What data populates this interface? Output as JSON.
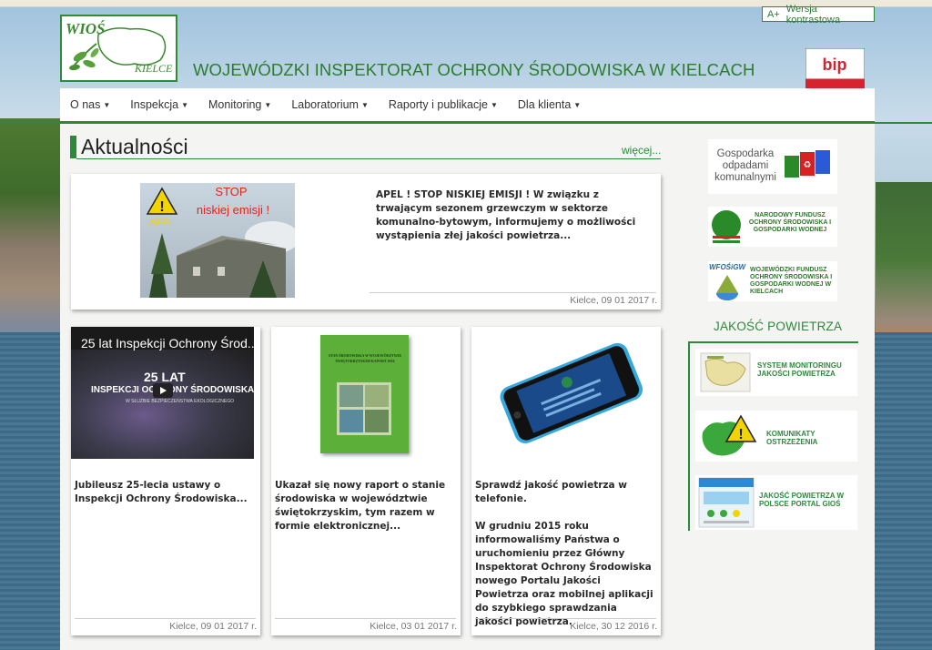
{
  "header": {
    "contrast_icon": "A+",
    "contrast_label": "Wersja kontrastowa",
    "logo_line1": "WIOŚ",
    "logo_line2": "KIELCE",
    "site_title": "WOJEWÓDZKI INSPEKTORAT OCHRONY ŚRODOWISKA W KIELCACH",
    "bip_label": "bip"
  },
  "nav": [
    {
      "label": "O nas"
    },
    {
      "label": "Inspekcja"
    },
    {
      "label": "Monitoring"
    },
    {
      "label": "Laboratorium"
    },
    {
      "label": "Raporty i publikacje"
    },
    {
      "label": "Dla klienta"
    }
  ],
  "news": {
    "section_title": "Aktualności",
    "more_link": "więcej...",
    "featured": {
      "image_text_1": "STOP",
      "image_text_2": "niskiej emisji !",
      "image_text_3": "APEL",
      "text": "APEL ! STOP NISKIEJ EMISJI ! W związku z trwającym sezonem grzewczym w sektorze komunalno-bytowym, informujemy o możliwości wystąpienia złej jakości powietrza...",
      "date": "Kielce, 09 01 2017 r."
    },
    "cards": [
      {
        "video_title": "25 lat Inspekcji Ochrony Środ...",
        "video_overlay_1": "25 LAT",
        "video_overlay_2": "INSPEKCJI OCHRONY ŚRODOWISKA",
        "video_overlay_3": "W SŁUŻBIE BEZPIECZEŃSTWA EKOLOGICZNEGO",
        "text": "Jubileusz 25-lecia ustawy o Inspekcji Ochrony Środowiska...",
        "date": "Kielce, 09 01 2017 r."
      },
      {
        "report_title": "STAN ŚRODOWISKA W WOJEWÓDZTWIE ŚWIĘTOKRZYSKIM RAPORT 2016",
        "text": "Ukazał się nowy raport o stanie środowiska w województwie świętokrzyskim, tym razem w formie elektronicznej...",
        "date": "Kielce, 03 01 2017 r."
      },
      {
        "text_1": "Sprawdź jakość powietrza w telefonie.",
        "text_2": "W grudniu 2015 roku informowaliśmy Państwa o uruchomieniu przez Główny Inspektorat Ochrony Środowiska nowego Portalu Jakości Powietrza oraz mobilnej aplikacji do szybkiego sprawdzania jakości powietrza.",
        "date": "Kielce, 30 12 2016 r."
      }
    ]
  },
  "sidebar": {
    "banner1": "Gospodarka odpadami komunalnymi",
    "banner2": "NARODOWY FUNDUSZ OCHRONY ŚRODOWISKA I GOSPODARKI WODNEJ",
    "banner3_logo": "WFOŚiGW",
    "banner3": "WOJEWÓDZKI FUNDUSZ OCHRONY ŚRODOWISKA I GOSPODARKI WODNEJ W KIELCACH",
    "air_title": "JAKOŚĆ POWIETRZA",
    "air_items": [
      {
        "label": "SYSTEM MONITORINGU JAKOŚCI POWIETRZA"
      },
      {
        "label": "KOMUNIKATY OSTRZEŻENIA"
      },
      {
        "label": "JAKOŚĆ POWIETRZA W POLSCE PORTAL GIOŚ"
      }
    ]
  },
  "colors": {
    "accent": "#2b8a3a",
    "bip_red": "#d7232f"
  }
}
